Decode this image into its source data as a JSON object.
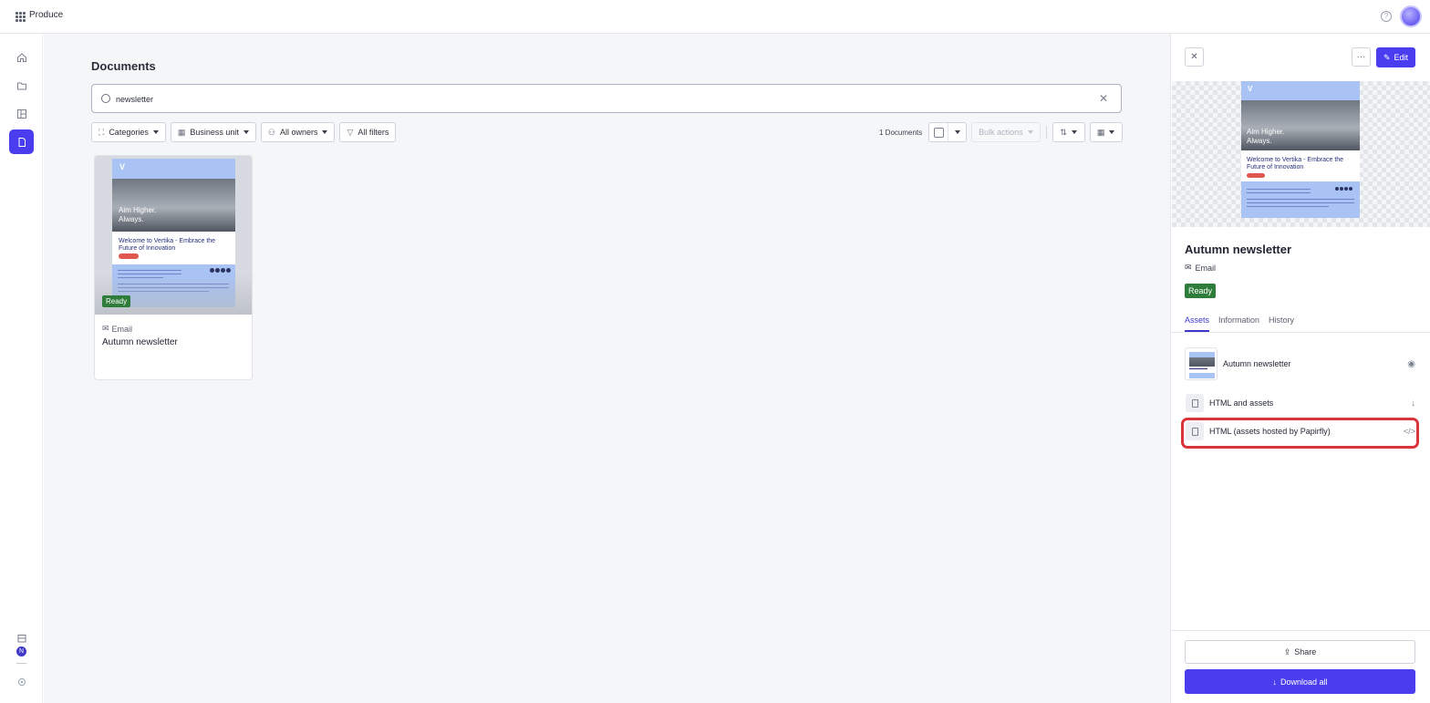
{
  "app": {
    "name": "Produce"
  },
  "nav": {
    "items": [
      "home-icon",
      "folder-icon",
      "layout-icon",
      "document-icon"
    ],
    "active": "document-icon",
    "badge": "N"
  },
  "main": {
    "title": "Documents",
    "search": {
      "value": "newsletter",
      "placeholder": ""
    },
    "filters": [
      {
        "label": "Categories",
        "icon": "categories-icon"
      },
      {
        "label": "Business unit",
        "icon": "business-unit-icon"
      },
      {
        "label": "All owners",
        "icon": "owner-icon"
      },
      {
        "label": "All filters",
        "icon": "filter-icon"
      }
    ],
    "doc_count": "1 Documents",
    "bulk_actions": "Bulk actions"
  },
  "card": {
    "type": "Email",
    "title": "Autumn newsletter",
    "status": "Ready",
    "preview": {
      "hero_line1": "Aim Higher.",
      "hero_line2": "Always.",
      "headline": "Welcome to Vertika - Embrace the Future of Innovation"
    }
  },
  "panel": {
    "edit_label": "Edit",
    "title": "Autumn newsletter",
    "type": "Email",
    "status": "Ready",
    "tabs": [
      {
        "label": "Assets",
        "active": true
      },
      {
        "label": "Information",
        "active": false
      },
      {
        "label": "History",
        "active": false
      }
    ],
    "assets": [
      {
        "label": "Autumn newsletter",
        "action": "eye-icon"
      },
      {
        "label": "HTML and assets",
        "action": "download-icon"
      },
      {
        "label": "HTML (assets hosted by Papirfly)",
        "action": "code-icon"
      }
    ],
    "share_label": "Share",
    "download_label": "Download all"
  },
  "colors": {
    "accent": "#4a3df0",
    "ready": "#2f7d3b",
    "highlight": "#d9343a"
  }
}
